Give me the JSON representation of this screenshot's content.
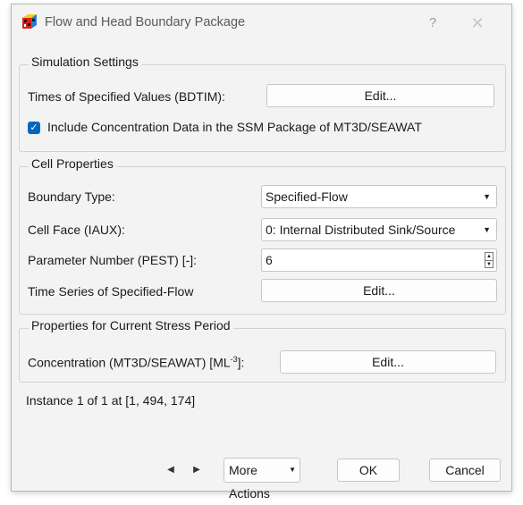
{
  "window": {
    "title": "Flow and Head Boundary Package",
    "help_icon": "?",
    "close_icon": "✕"
  },
  "simulation_settings": {
    "legend": "Simulation Settings",
    "times_label": "Times of Specified Values (BDTIM):",
    "times_button": "Edit...",
    "include_conc_checked": true,
    "include_conc_label": "Include Concentration Data in the SSM Package of MT3D/SEAWAT"
  },
  "cell_properties": {
    "legend": "Cell Properties",
    "boundary_type_label": "Boundary Type:",
    "boundary_type_value": "Specified-Flow",
    "cell_face_label": "Cell Face (IAUX):",
    "cell_face_value": "0: Internal Distributed Sink/Source",
    "param_label": "Parameter Number (PEST) [-]:",
    "param_value": "6",
    "time_series_label": "Time Series of Specified-Flow",
    "time_series_button": "Edit..."
  },
  "stress_period": {
    "legend": "Properties for Current Stress Period",
    "conc_label_main": "Concentration (MT3D/SEAWAT) [ML",
    "conc_label_sup": "-3",
    "conc_label_end": "]:",
    "conc_button": "Edit..."
  },
  "status_text": "Instance 1 of 1 at [1, 494, 174]",
  "footer": {
    "prev_icon": "◀",
    "next_icon": "▶",
    "more_actions": "More Actions",
    "ok": "OK",
    "cancel": "Cancel"
  },
  "colors": {
    "accent": "#0067c0",
    "window_bg": "#f3f3f3"
  }
}
